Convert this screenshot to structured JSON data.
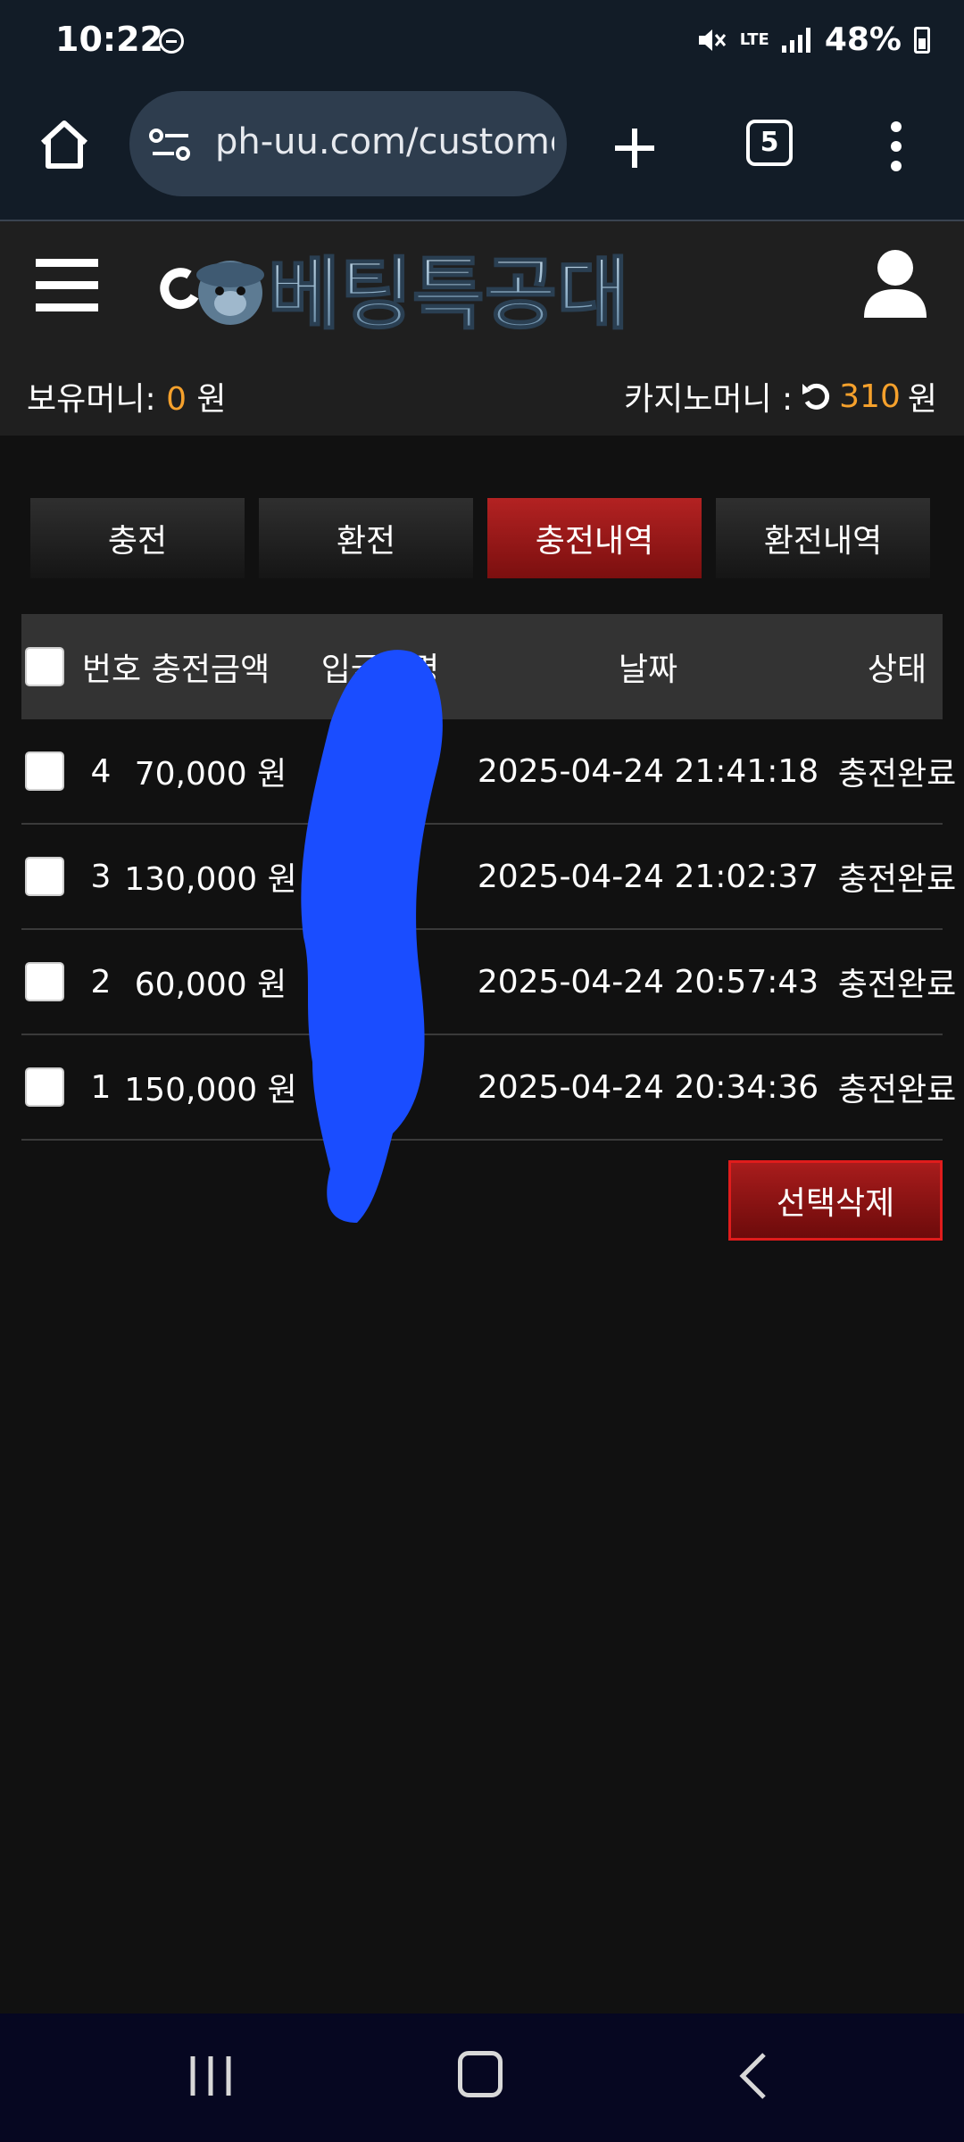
{
  "status_bar": {
    "time": "10:22",
    "lte": "LTE",
    "battery": "48%"
  },
  "browser": {
    "url": "ph-uu.com/custome",
    "tab_count": "5"
  },
  "header": {
    "logo_text": "베팅특공대",
    "hold_money_label": "보유머니:",
    "hold_money_value": "0",
    "casino_money_label": "카지노머니 :",
    "casino_money_value": "310",
    "currency": "원"
  },
  "tabs": [
    {
      "label": "충전",
      "active": false
    },
    {
      "label": "환전",
      "active": false
    },
    {
      "label": "충전내역",
      "active": true
    },
    {
      "label": "환전내역",
      "active": false
    }
  ],
  "table": {
    "columns": [
      "번호",
      "충전금액",
      "입금자명",
      "날짜",
      "상태"
    ],
    "rows": [
      {
        "num": "4",
        "amount": "70,000 원",
        "date": "2025-04-24 21:41:18",
        "status": "충전완료"
      },
      {
        "num": "3",
        "amount": "130,000 원",
        "date": "2025-04-24 21:02:37",
        "status": "충전완료"
      },
      {
        "num": "2",
        "amount": "60,000 원",
        "date": "2025-04-24 20:57:43",
        "status": "충전완료"
      },
      {
        "num": "1",
        "amount": "150,000 원",
        "date": "2025-04-24 20:34:36",
        "status": "충전완료"
      }
    ]
  },
  "delete_button": "선택삭제",
  "colors": {
    "accent_red": "#a81c1c",
    "money_orange": "#f6a12c",
    "redaction_blue": "#1a4dff"
  }
}
